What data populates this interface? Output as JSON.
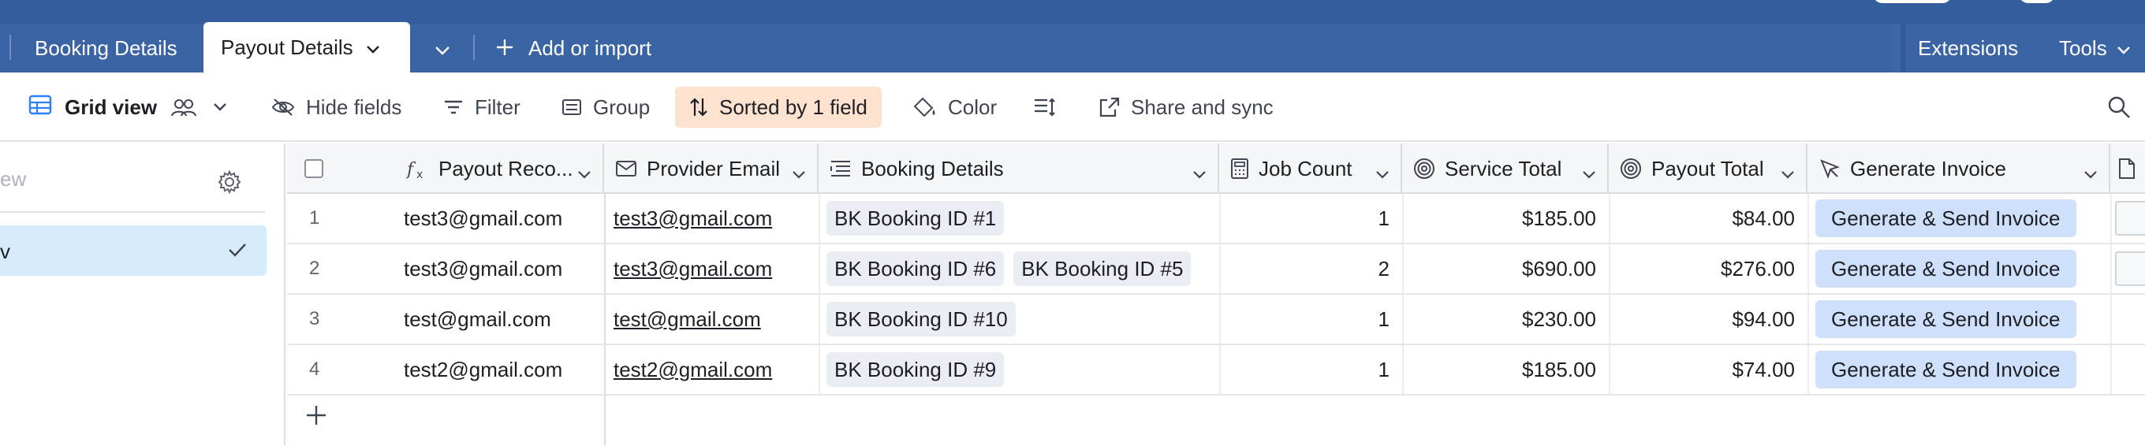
{
  "tabs": {
    "booking_details": "Booking Details",
    "payout_details": "Payout Details",
    "add_or_import": "Add or import",
    "extensions": "Extensions",
    "tools": "Tools"
  },
  "toolbar": {
    "view_name": "Grid view",
    "hide_fields": "Hide fields",
    "filter": "Filter",
    "group": "Group",
    "sorted": "Sorted by 1 field",
    "color": "Color",
    "share_and_sync": "Share and sync"
  },
  "sidebar": {
    "search_placeholder_visible": "ew",
    "selected_item_visible": "v"
  },
  "columns": [
    {
      "label": "Payout Reco...",
      "icon": "formula-icon"
    },
    {
      "label": "Provider Email",
      "icon": "email-icon"
    },
    {
      "label": "Booking Details",
      "icon": "linked-record-icon"
    },
    {
      "label": "Job Count",
      "icon": "count-icon"
    },
    {
      "label": "Service Total",
      "icon": "rollup-icon"
    },
    {
      "label": "Payout Total",
      "icon": "rollup-icon"
    },
    {
      "label": "Generate Invoice",
      "icon": "button-cursor-icon"
    }
  ],
  "rows": [
    {
      "num": "1",
      "payout_record": "test3@gmail.com",
      "provider_email": "test3@gmail.com",
      "bookings": [
        "BK Booking ID #1"
      ],
      "job_count": "1",
      "service_total": "$185.00",
      "payout_total": "$84.00",
      "invoice": "Generate & Send Invoice"
    },
    {
      "num": "2",
      "payout_record": "test3@gmail.com",
      "provider_email": "test3@gmail.com",
      "bookings": [
        "BK Booking ID #6",
        "BK Booking ID #5"
      ],
      "job_count": "2",
      "service_total": "$690.00",
      "payout_total": "$276.00",
      "invoice": "Generate & Send Invoice"
    },
    {
      "num": "3",
      "payout_record": "test@gmail.com",
      "provider_email": "test@gmail.com",
      "bookings": [
        "BK Booking ID #10"
      ],
      "job_count": "1",
      "service_total": "$230.00",
      "payout_total": "$94.00",
      "invoice": "Generate & Send Invoice"
    },
    {
      "num": "4",
      "payout_record": "test2@gmail.com",
      "provider_email": "test2@gmail.com",
      "bookings": [
        "BK Booking ID #9"
      ],
      "job_count": "1",
      "service_total": "$185.00",
      "payout_total": "$74.00",
      "invoice": "Generate & Send Invoice"
    }
  ],
  "colors": {
    "topbar": "#3c67a8",
    "sorted_bg": "#fde2cf",
    "invoice_button": "#cfe0fb",
    "selected_view": "#d5ecfa"
  }
}
